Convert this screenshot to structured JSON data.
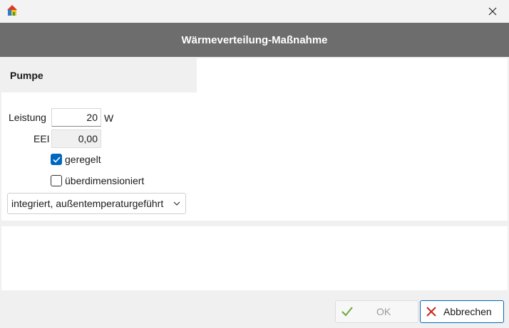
{
  "window": {
    "app_icon": "house-icon",
    "close_icon": "close-icon"
  },
  "header": {
    "title": "Wärmeverteilung-Maßnahme"
  },
  "section": {
    "title": "Pumpe"
  },
  "form": {
    "leistung_label": "Leistung",
    "leistung_value": "20",
    "leistung_unit": "W",
    "eei_label": "EEI",
    "eei_value": "0,00",
    "geregelt_label": "geregelt",
    "geregelt_checked": true,
    "ueberdimensioniert_label": "überdimensioniert",
    "ueberdimensioniert_checked": false,
    "mode_selected": "integriert, außentemperaturgeführt"
  },
  "buttons": {
    "ok_label": "OK",
    "ok_icon": "checkmark-icon",
    "ok_icon_color": "#6aaa3a",
    "cancel_label": "Abbrechen",
    "cancel_icon": "x-icon",
    "cancel_icon_color": "#c42b1c"
  },
  "colors": {
    "accent": "#0067c0",
    "header_bg": "#6d6d6d"
  }
}
